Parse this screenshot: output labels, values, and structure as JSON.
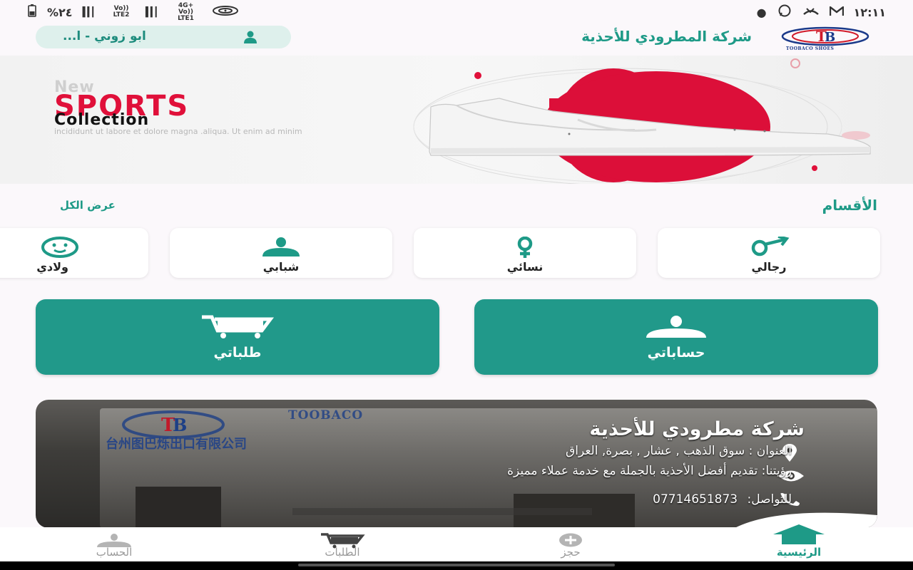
{
  "status_bar": {
    "time": "١٢:١١",
    "battery": "%٢٤",
    "net1": "Vo)) LTE2",
    "net2": "4G+ Vo)) LTE1"
  },
  "header": {
    "user_name": "ابو زوني - ا...",
    "company_title": "شركة المطرودي للأحذية",
    "logo_text": "TOOBACO SHOES"
  },
  "banner": {
    "new_text": "New",
    "sports_text": "SPORTS",
    "collection_text": "Collection",
    "lorem_text": "incididunt ut labore et dolore magna .aliqua. Ut enim ad minim"
  },
  "categories": {
    "title": "الأقسام",
    "view_all": "عرض الكل",
    "items": [
      {
        "label": "رجالي",
        "icon": "male-icon"
      },
      {
        "label": "نسائي",
        "icon": "female-icon"
      },
      {
        "label": "شبابي",
        "icon": "person-icon"
      },
      {
        "label": "ولادي",
        "icon": "baby-face-icon"
      }
    ]
  },
  "actions": {
    "accounts_label": "حساباتي",
    "orders_label": "طلباتي"
  },
  "company_card": {
    "title": "شركة مطرودي للأحذية",
    "address": "العنوان : سوق الذهب , عشار , بصرة, العراق",
    "vision": "رؤيتنا: تقديم أفضل الأحذية بالجملة مع خدمة عملاء مميزة",
    "contact_label": "للتواصل:",
    "phone": "07714651873",
    "sign_text_en": "TOOBACO",
    "sign_text_cn": "台州图巴烁出口有限公司"
  },
  "bottom_nav": {
    "items": [
      {
        "label": "الرئيسية",
        "icon": "home-icon",
        "active": true
      },
      {
        "label": "حجز",
        "icon": "add-circle-icon",
        "active": false
      },
      {
        "label": "الطلبات",
        "icon": "cart-icon",
        "active": false
      },
      {
        "label": "الحساب",
        "icon": "account-icon",
        "active": false
      }
    ]
  },
  "colors": {
    "primary": "#21998a",
    "accent_red": "#e0103a",
    "text_dark": "#222222",
    "muted": "#9a9a9a"
  }
}
